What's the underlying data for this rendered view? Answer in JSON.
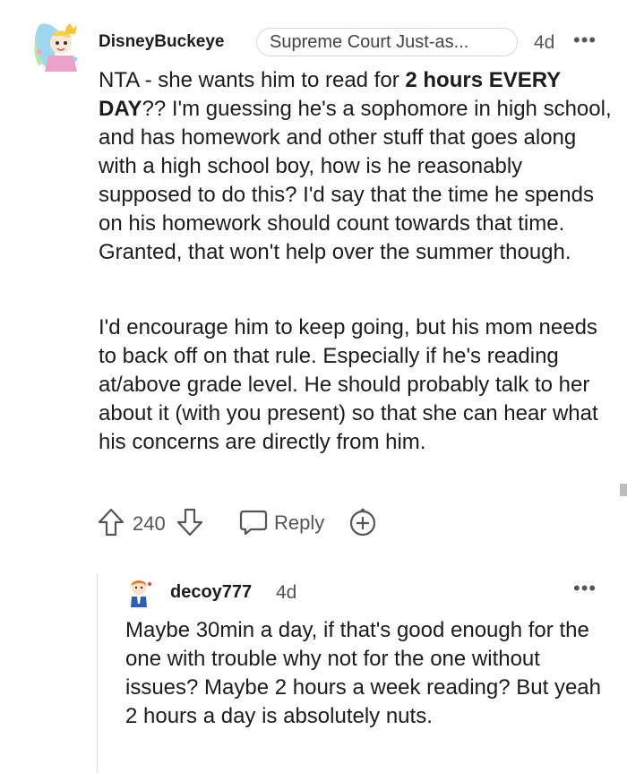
{
  "comment": {
    "username": "DisneyBuckeye",
    "flair": "Supreme Court Just-as...",
    "age": "4d",
    "more_label": "•••",
    "para1": {
      "lead": "NTA - she wants him to read for ",
      "bold1": "2 hours",
      "space": " ",
      "bold2": "EVERY DAY",
      "rest": "?? I'm guessing he's a sophomore in high school, and has homework and other stuff that goes along with a high school boy, how is he reasonably supposed to do this? I'd say that the time he spends on his homework should count towards that time. Granted, that won't help over the summer though."
    },
    "para2": "I'd encourage him to keep going, but his mom needs to back off on that rule. Especially if he's reading at/above grade level. He should probably talk to her about it (with you present) so that she can hear what his concerns are directly from him.",
    "score": "240",
    "reply_label": "Reply"
  },
  "reply": {
    "username": "decoy777",
    "age": "4d",
    "more_label": "•••",
    "text": "Maybe 30min a day, if that's good enough for the one with trouble why not for the one without issues? Maybe 2 hours a week reading? But yeah 2 hours a day is absolutely nuts."
  },
  "icons": {
    "avatar": "avatar-icon",
    "upvote": "upvote-arrow-icon",
    "downvote": "downvote-arrow-icon",
    "reply": "speech-bubble-icon",
    "award": "award-plus-icon"
  }
}
